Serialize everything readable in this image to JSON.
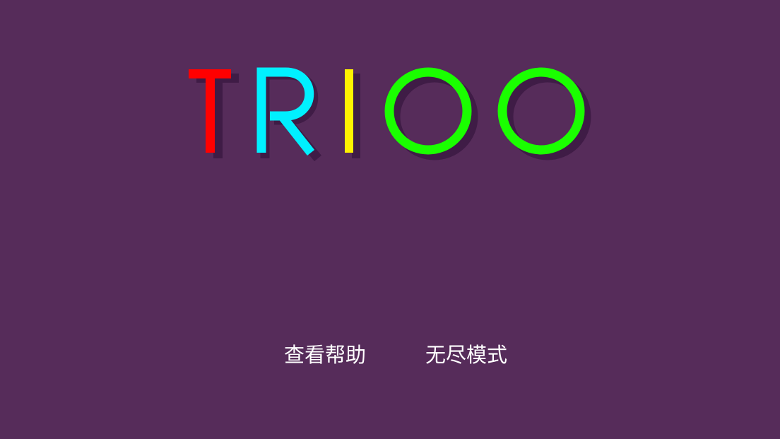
{
  "theme": {
    "background": "#562c5a",
    "shadow": "#3f1c46",
    "menu_text_color": "#ffffff"
  },
  "logo": {
    "text": "TRIOO",
    "letters": [
      {
        "char": "T",
        "color": "#ff0000"
      },
      {
        "char": "R",
        "color": "#00f0ff"
      },
      {
        "char": "I",
        "color": "#fff200"
      },
      {
        "char": "O",
        "color": "#1aff00"
      },
      {
        "char": "O",
        "color": "#1aff00"
      }
    ]
  },
  "menu": {
    "help_label": "查看帮助",
    "endless_label": "无尽模式"
  }
}
